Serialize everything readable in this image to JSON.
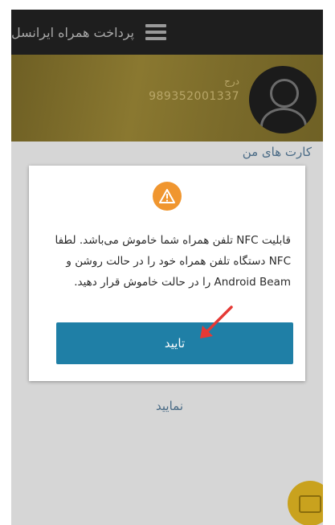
{
  "app_bar": {
    "title": "پرداخت همراه ایرانسل"
  },
  "profile": {
    "name": "درج",
    "phone": "989352001337"
  },
  "section": {
    "title": "کارت های من"
  },
  "background_action": {
    "label": "نمایید"
  },
  "dialog": {
    "message": "قابلیت NFC تلفن همراه شما خاموش می‌باشد. لطفا NFC دستگاه تلفن همراه خود را در حالت روشن و Android Beam را در حالت خاموش قرار دهید.",
    "confirm_label": "تایید"
  },
  "colors": {
    "app_bar": "#1e1e1e",
    "profile_banner": "#7a6a2a",
    "accent_button": "#1f7fa6",
    "warning": "#f0962f",
    "annotation_arrow": "#e53935",
    "fab": "#c9a21e"
  },
  "icons": [
    "hamburger-icon",
    "avatar-icon",
    "warning-icon",
    "card-icon"
  ]
}
